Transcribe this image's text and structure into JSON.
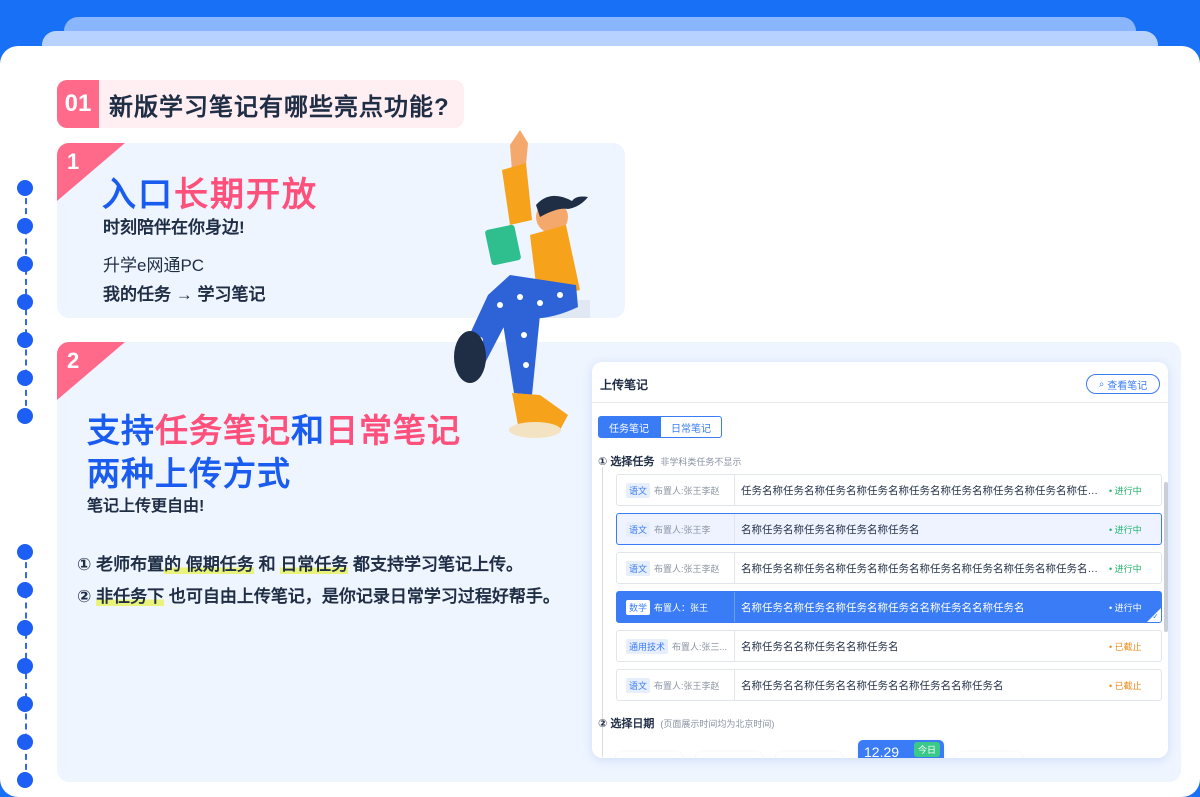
{
  "heading": {
    "number": "01",
    "title": "新版学习笔记有哪些亮点功能?"
  },
  "card1": {
    "badge": "1",
    "title_blue": "入口",
    "title_pink": "长期开放",
    "subtitle": "时刻陪伴在你身边!",
    "line1": "升学e网通PC",
    "line2": "我的任务 → 学习笔记"
  },
  "card2": {
    "badge": "2",
    "t1_blue": "支持",
    "t1_pink1": "任务笔记",
    "t1_blue2": "和",
    "t1_pink2": "日常笔记",
    "t2": "两种上传方式",
    "subtitle": "笔记上传更自由!",
    "p1": {
      "a": "① 老师布置",
      "b": "的 假期任务",
      "c": " 和 ",
      "d": "日常任务",
      "e": " 都支持学习笔记上传。"
    },
    "p2": {
      "a": "② ",
      "b": "非任务下",
      "c": " 也可自由上传笔记，是你记录日常学习过程好帮手。"
    }
  },
  "panel": {
    "title": "上传笔记",
    "view_button": "查看笔记",
    "tabs": [
      "任务笔记",
      "日常笔记"
    ],
    "step1": "① 选择任务",
    "step1_hint": "非学科类任务不显示",
    "rows": [
      {
        "subject": "语文",
        "assigner": "布置人:张王李赵",
        "name": "任务名称任务名称任务名称任务名称任务名称任务名称任务名称任务名称任务名称任务名称",
        "status": "• 进行中"
      },
      {
        "subject": "语文",
        "assigner": "布置人:张王李",
        "name": "名称任务名称任务名称任务名称任务名",
        "status": "• 进行中"
      },
      {
        "subject": "语文",
        "assigner": "布置人:张王李赵",
        "name": "名称任务名称任务名称任务名称任务名称任务名称任务名称任务名称任务名称任务名",
        "status": "• 进行中"
      },
      {
        "subject": "数学",
        "assigner": "布置人：张王",
        "name": "名称任务名称任务名称任务名称任务名名称任务名名称任务名",
        "status": "• 进行中"
      },
      {
        "subject": "通用技术",
        "assigner": "布置人:张三...",
        "name": "名称任务名名称任务名名称任务名",
        "status": "• 已截止"
      },
      {
        "subject": "语文",
        "assigner": "布置人:张王李赵",
        "name": "名称任务名名称任务名名称任务名名称任务名名称任务名",
        "status": "• 已截止"
      }
    ],
    "step2": "② 选择日期",
    "step2_hint": "(页面展示时间均为北京时间)",
    "date_selected": "12.29",
    "today_label": "今日"
  },
  "colors": {
    "brand_blue": "#1a5cf0",
    "accent_pink": "#ff4f7b",
    "status_green": "#21b36b",
    "status_orange": "#f08a1c"
  }
}
